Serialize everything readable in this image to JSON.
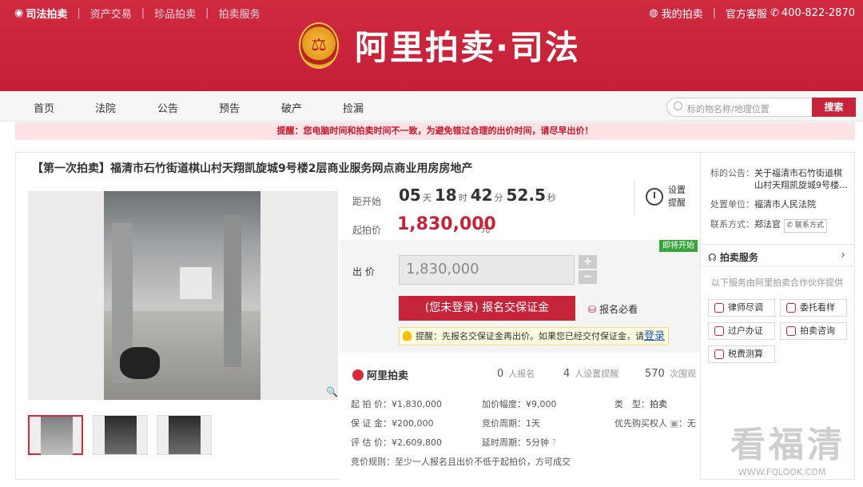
{
  "topbar": {
    "brand": "司法拍卖",
    "links": [
      "资产交易",
      "珍品拍卖",
      "拍卖服务"
    ],
    "my_auction": "我的拍卖",
    "service": "官方客服",
    "phone": "400-822-2870"
  },
  "logo": {
    "text": "阿里拍卖·司法"
  },
  "nav": {
    "items": [
      "首页",
      "法院",
      "公告",
      "预告",
      "破产",
      "捡漏"
    ]
  },
  "search": {
    "placeholder": "标的物名称/地理位置",
    "button": "搜索"
  },
  "notice": "提醒：您电脑时间和拍卖时间不一致，为避免错过合理的出价时间，请尽早出价！",
  "item": {
    "title": "【第一次拍卖】福清市石竹街道棋山村天翔凯旋城9号楼2层商业服务网点商业用房房地产",
    "countdown_label": "距开始",
    "days": "05",
    "days_unit": "天",
    "hours": "18",
    "hours_unit": "时",
    "minutes": "42",
    "minutes_unit": "分",
    "seconds": "52.5",
    "seconds_unit": "秒",
    "start_price_label": "起拍价",
    "start_price": "1,830,000",
    "currency": "元",
    "remind": "设置提醒",
    "badge": "即将开始",
    "bid_label": "出 价",
    "bid_value": "1,830,000",
    "plus": "+",
    "minus": "−",
    "register_button": "(您未登录) 报名交保证金",
    "must_read": "报名必看",
    "tip_text": "提醒：先报名交保证金再出价。如果您已经交付保证金，请",
    "tip_login": "登录"
  },
  "stats": {
    "brand": "阿里拍卖",
    "signups": "0",
    "signups_label": "人报名",
    "reminders": "4",
    "reminders_label": "人设置提醒",
    "views": "570",
    "views_label": "次围观",
    "start_price": "起 拍 价：¥1,830,000",
    "deposit": "保 证 金：¥200,000",
    "appraisal": "评 估 价：¥2,609,800",
    "increment": "加价幅度：¥9,000",
    "period": "竞价周期：1天",
    "delay": "延时周期：5分钟",
    "type_label": "类　型：",
    "type_value": "拍卖",
    "priority": "优先购买权人",
    "priority_value": "：无",
    "rule": "竞价规则：至少一人报名且出价不低于起拍价，方可成交"
  },
  "side": {
    "announce_label": "标的公告：",
    "announce_value": "关于福清市石竹街道棋山村天翔凯旋城9号楼...",
    "unit_label": "处置单位：",
    "unit_value": "福清市人民法院",
    "contact_label": "联系方式：",
    "contact_name": "郑法官",
    "contact_btn": "联系方式",
    "service_title": "拍卖服务",
    "service_desc": "以下服务由阿里拍卖合作伙伴提供",
    "services": [
      "律师尽调",
      "委托看样",
      "过户办证",
      "拍卖咨询",
      "税费测算"
    ]
  },
  "watermark": {
    "big": "看福清",
    "small": "WWW.FQLOOK.COM"
  },
  "colors": {
    "brand_red": "#c6243a",
    "badge_green": "#37a63a"
  }
}
